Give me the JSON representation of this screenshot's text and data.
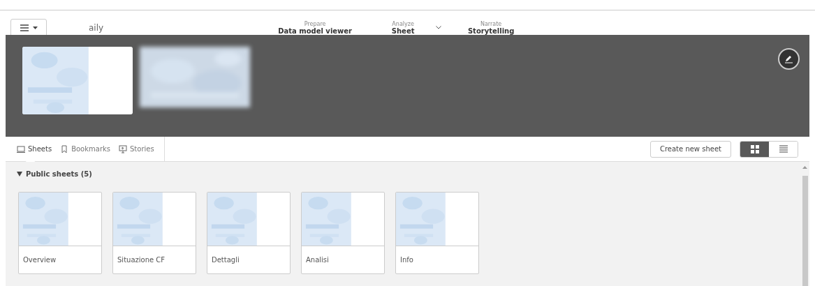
{
  "app_title": "aily",
  "nav": [
    {
      "label": "Prepare",
      "value": "Data model viewer",
      "dropdown": false
    },
    {
      "label": "Analyze",
      "value": "Sheet",
      "dropdown": true
    },
    {
      "label": "Narrate",
      "value": "Storytelling",
      "dropdown": false
    }
  ],
  "tabs": [
    {
      "label": "Sheets",
      "selected": true
    },
    {
      "label": "Bookmarks",
      "selected": false
    },
    {
      "label": "Stories",
      "selected": false
    }
  ],
  "create_button": "Create new sheet",
  "view_toggle": [
    {
      "selected": true
    },
    {
      "selected": false
    }
  ],
  "section": {
    "title": "Public sheets (5)",
    "expanded": true
  },
  "sheets": [
    {
      "title": "Overview"
    },
    {
      "title": "Situazione CF"
    },
    {
      "title": "Dettagli"
    },
    {
      "title": "Analisi"
    },
    {
      "title": "Info"
    }
  ]
}
